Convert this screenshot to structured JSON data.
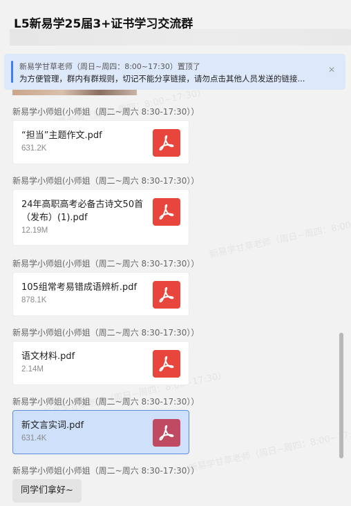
{
  "header": {
    "title": "L5新易学25届3+证书学习交流群"
  },
  "pinned": {
    "head": "新易学甘草老师（周日~周四：8:00~17:30）置顶了",
    "body": "为方便管理，群内有群规则，切记不能分享链接，请勿点击其他人员发送的链接..."
  },
  "messages": [
    {
      "sender": "新易学小师姐(小师姐（周二~周六 8:30-17:30））",
      "file": "“担当”主题作文.pdf",
      "size": "631.2K"
    },
    {
      "sender": "新易学小师姐(小师姐（周二~周六 8:30-17:30））",
      "file": "24年高职高考必备古诗文50首（发布）(1).pdf",
      "size": "12.19M"
    },
    {
      "sender": "新易学小师姐(小师姐（周二~周六 8:30-17:30））",
      "file": "105组常考易错成语辨析.pdf",
      "size": "878.1K"
    },
    {
      "sender": "新易学小师姐(小师姐（周二~周六 8:30-17:30））",
      "file": "语文材料.pdf",
      "size": "2.14M"
    },
    {
      "sender": "新易学小师姐(小师姐（周二~周六 8:30-17:30））",
      "file": "新文言实词.pdf",
      "size": "631.4K"
    },
    {
      "sender": "新易学小师姐(小师姐（周二~周六 8:30-17:30））",
      "text": "同学们拿好~"
    }
  ],
  "watermark": "新易学甘草老师（周日~周四：8:00~17:30）",
  "colors": {
    "pdf": "#e8453c",
    "selected_bg": "#cfe0fb",
    "pinned_bg": "#dde9fb",
    "accent": "#3d7ef0"
  },
  "icons": {
    "file": "pdf-icon",
    "close": "close-icon"
  }
}
